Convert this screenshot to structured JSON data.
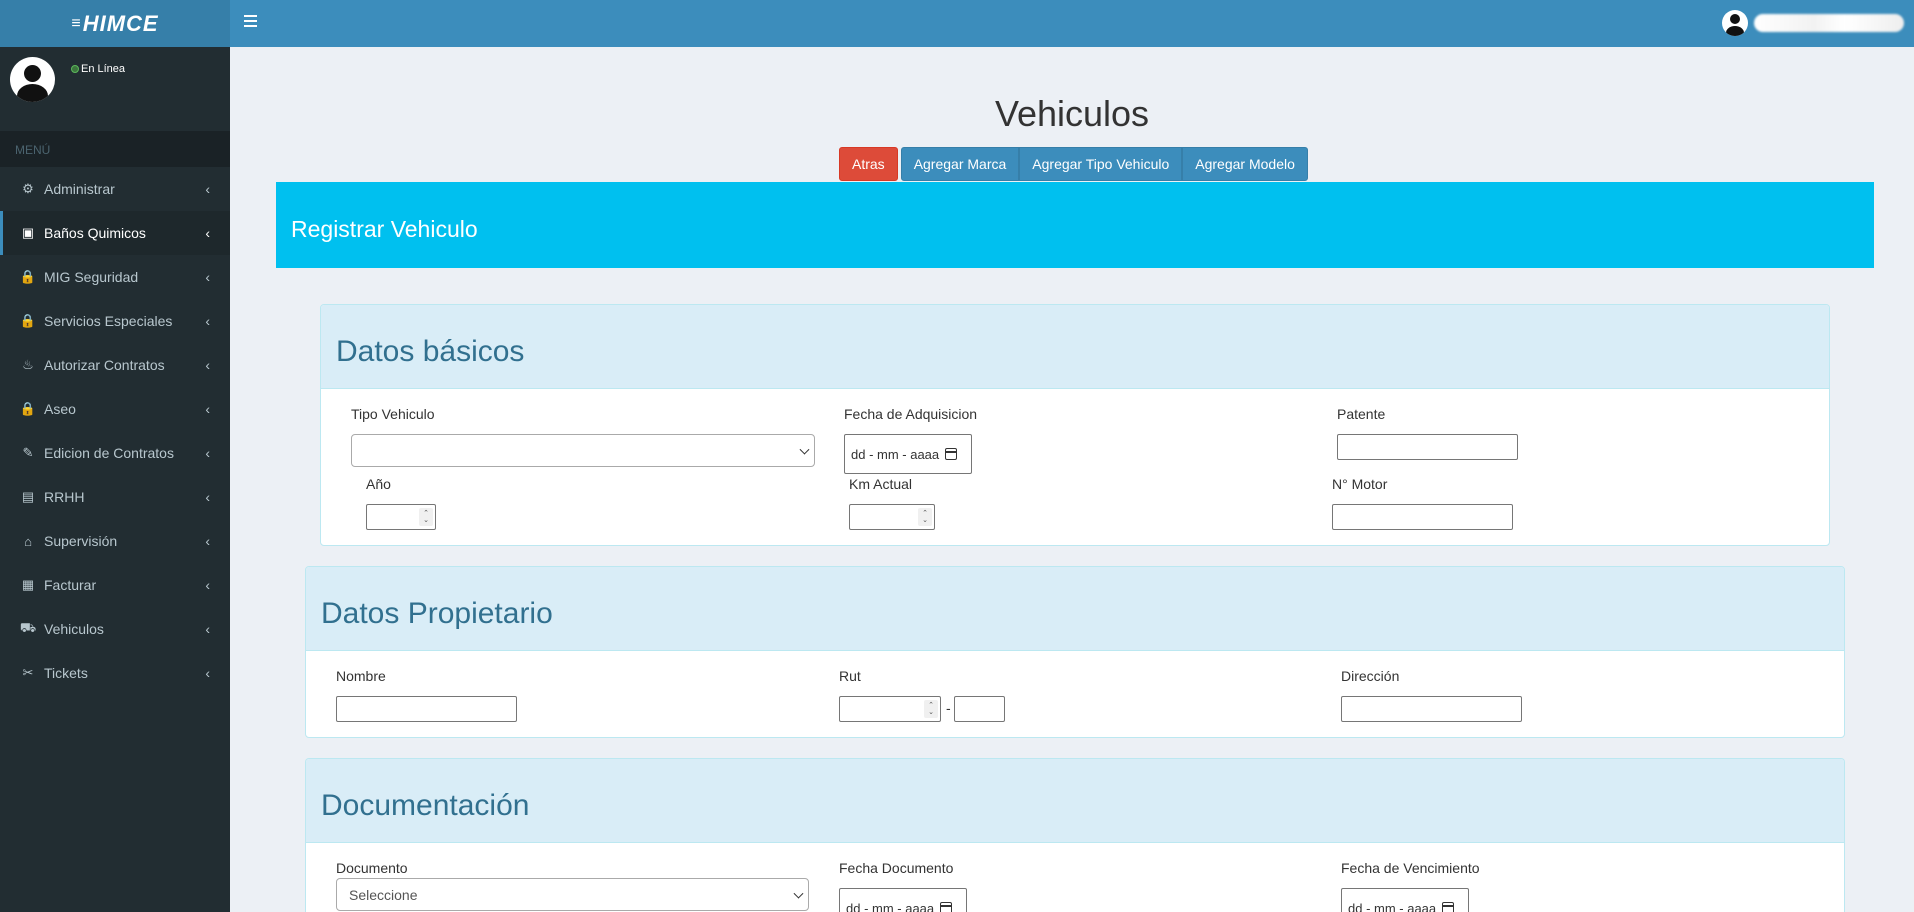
{
  "header": {
    "logo": "HIMCE",
    "logo_prefix": "≡"
  },
  "sidebar": {
    "status": "En Línea",
    "menu_header": "MENÚ",
    "items": [
      {
        "label": "Administrar",
        "icon": "cogs-icon",
        "glyph": "⚙"
      },
      {
        "label": "Baños Quimicos",
        "icon": "briefcase-icon",
        "glyph": "▣"
      },
      {
        "label": "MIG Seguridad",
        "icon": "lock-icon",
        "glyph": "🔒"
      },
      {
        "label": "Servicios Especiales",
        "icon": "lock-icon",
        "glyph": "🔒"
      },
      {
        "label": "Autorizar Contratos",
        "icon": "fire-icon",
        "glyph": "♨"
      },
      {
        "label": "Aseo",
        "icon": "lock-icon",
        "glyph": "🔒"
      },
      {
        "label": "Edicion de Contratos",
        "icon": "edit-icon",
        "glyph": "✎"
      },
      {
        "label": "RRHH",
        "icon": "book-icon",
        "glyph": "▤"
      },
      {
        "label": "Supervisión",
        "icon": "bank-icon",
        "glyph": "⌂"
      },
      {
        "label": "Facturar",
        "icon": "archive-icon",
        "glyph": "▦"
      },
      {
        "label": "Vehiculos",
        "icon": "car-icon",
        "glyph": "⛟"
      },
      {
        "label": "Tickets",
        "icon": "ticket-icon",
        "glyph": "✂"
      }
    ],
    "active_index": 1
  },
  "page": {
    "title": "Vehiculos",
    "buttons": {
      "back": "Atras",
      "add_brand": "Agregar Marca",
      "add_type": "Agregar Tipo Vehiculo",
      "add_model": "Agregar Modelo"
    },
    "register_title": "Registrar Vehiculo"
  },
  "basic": {
    "title": "Datos básicos",
    "tipo_label": "Tipo Vehiculo",
    "tipo_value": "",
    "fecha_label": "Fecha de Adquisicion",
    "fecha_placeholder": "dd - mm - aaaa",
    "patente_label": "Patente",
    "patente_value": "",
    "anio_label": "Año",
    "km_label": "Km Actual",
    "motor_label": "N° Motor"
  },
  "owner": {
    "title": "Datos Propietario",
    "nombre_label": "Nombre",
    "rut_label": "Rut",
    "rut_separator": "-",
    "direccion_label": "Dirección"
  },
  "docs": {
    "title": "Documentación",
    "documento_label": "Documento",
    "documento_value": "Seleccione",
    "fecha_doc_label": "Fecha Documento",
    "fecha_doc_placeholder": "dd - mm - aaaa",
    "fecha_venc_label": "Fecha de Vencimiento",
    "fecha_venc_placeholder": "dd - mm - aaaa"
  }
}
